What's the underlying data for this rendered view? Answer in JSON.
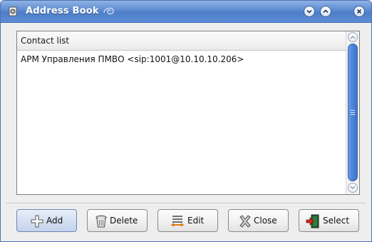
{
  "window": {
    "title": "Address Book",
    "title_icon": "gear-paper-icon",
    "controls": [
      {
        "name": "minimize",
        "icon": "chevron-down-icon"
      },
      {
        "name": "maximize",
        "icon": "chevron-up-icon"
      },
      {
        "name": "close",
        "icon": "close-icon"
      }
    ]
  },
  "list": {
    "header": "Contact list",
    "items": [
      "АРМ Управления ПМВО <sip:1001@10.10.10.206>"
    ]
  },
  "buttons": {
    "add": "Add",
    "delete": "Delete",
    "edit": "Edit",
    "close": "Close",
    "select": "Select"
  },
  "colors": {
    "titlebar": "#5d8bd1",
    "scrollbar_thumb": "#4f86d8"
  }
}
